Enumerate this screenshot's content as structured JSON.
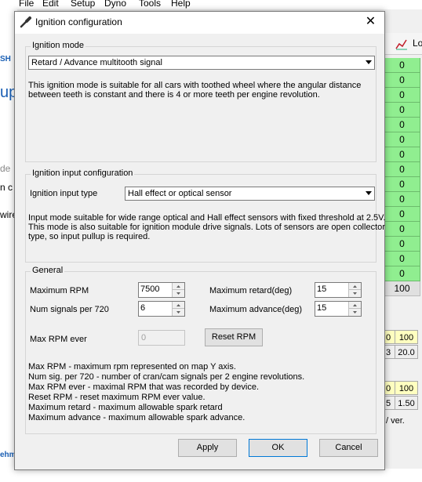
{
  "background": {
    "menu": [
      "File",
      "Edit",
      "Setup",
      "Dyno",
      "Tools",
      "Help"
    ],
    "left_fragments": [
      "SH",
      "up",
      "de",
      "n c",
      "wire",
      "ehm"
    ],
    "toolbar_text": "Lo",
    "grid_values": [
      "0",
      "0",
      "0",
      "0",
      "0",
      "0",
      "0",
      "0",
      "0",
      "0",
      "0",
      "0",
      "0",
      "0",
      "0",
      "100"
    ],
    "row1": [
      "0",
      "100"
    ],
    "row2": [
      "3",
      "20.0"
    ],
    "row3": [
      "0",
      "100"
    ],
    "row4": [
      "5",
      "1.50"
    ],
    "ver_text": "/ ver."
  },
  "dialog": {
    "title": "Ignition configuration",
    "close_glyph": "✕",
    "ignition_mode": {
      "legend": "Ignition mode",
      "selected": "Retard / Advance multitooth signal",
      "description": [
        "This ignition mode is suitable for all cars with toothed wheel where the angular distance",
        "between teeth is constant and there is 4 or more teeth per engine revolution."
      ]
    },
    "input_config": {
      "legend": "Ignition input configuration",
      "type_label": "Ignition input type",
      "selected": "Hall effect or optical sensor",
      "description": [
        "Input mode suitable for wide range optical and Hall effect sensors with fixed threshold at 2.5V.",
        "This mode is also suitable for ignition module drive signals. Lots of sensors are open collector",
        "type, so input pullup is required."
      ]
    },
    "general": {
      "legend": "General",
      "max_rpm_label": "Maximum RPM",
      "max_rpm_value": "7500",
      "num_signals_label": "Num signals per 720",
      "num_signals_value": "6",
      "max_retard_label": "Maximum retard(deg)",
      "max_retard_value": "15",
      "max_advance_label": "Maximum advance(deg)",
      "max_advance_value": "15",
      "max_rpm_ever_label": "Max RPM ever",
      "max_rpm_ever_value": "0",
      "reset_rpm_label": "Reset RPM",
      "help": [
        "Max RPM - maximum rpm represented on map Y axis.",
        "Num sig. per 720 - number of cran/cam signals per 2 engine revolutions.",
        "Max RPM ever - maximal RPM that was recorded by device.",
        "Reset RPM - reset maximum RPM ever value.",
        "Maximum retard - maximum allowable spark retard",
        "Maximum advance - maximum allowable spark advance."
      ]
    },
    "buttons": {
      "apply": "Apply",
      "ok": "OK",
      "cancel": "Cancel"
    }
  }
}
